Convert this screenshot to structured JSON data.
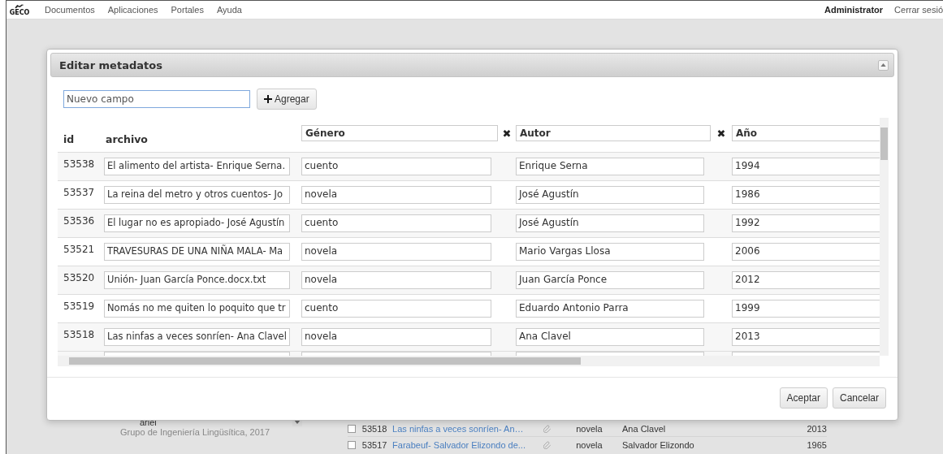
{
  "navbar": {
    "logo_text": "GECO",
    "menu": [
      "Documentos",
      "Aplicaciones",
      "Portales",
      "Ayuda"
    ],
    "user": "Administrator",
    "logout": "Cerrar sesió"
  },
  "background": {
    "user_select": "ariel",
    "footer": "Grupo de Ingeniería Lingüsítica, 2017",
    "rows": [
      {
        "checked": false,
        "id": "53518",
        "archivo": "Las ninfas a veces sonríen- An…",
        "genero": "novela",
        "autor": "Ana Clavel",
        "anio": "2013"
      },
      {
        "checked": false,
        "id": "53517",
        "archivo": "Farabeuf- Salvador Elizondo de...",
        "genero": "novela",
        "autor": "Salvador Elizondo",
        "anio": "1965"
      }
    ]
  },
  "dialog": {
    "title": "Editar metadatos",
    "new_field": {
      "placeholder": "Nuevo campo"
    },
    "add_button": "Agregar",
    "id_header": "id",
    "file_header": "archivo",
    "columns": [
      {
        "name": "Género",
        "remove": "✖"
      },
      {
        "name": "Autor",
        "remove": "✖"
      },
      {
        "name": "Año"
      }
    ],
    "rows": [
      {
        "id": "53538",
        "archivo": "El alimento del artista- Enrique Serna.",
        "values": [
          "cuento",
          "Enrique Serna",
          "1994"
        ]
      },
      {
        "id": "53537",
        "archivo": "La reina del metro y otros cuentos- Jo",
        "values": [
          "novela",
          "José Agustín",
          "1986"
        ]
      },
      {
        "id": "53536",
        "archivo": "El lugar no es apropiado- José Agustín",
        "values": [
          "cuento",
          "José Agustín",
          "1992"
        ]
      },
      {
        "id": "53521",
        "archivo": "TRAVESURAS DE UNA NIÑA MALA- Ma",
        "values": [
          "novela",
          "Mario Vargas Llosa",
          "2006"
        ]
      },
      {
        "id": "53520",
        "archivo": "Unión- Juan García Ponce.docx.txt",
        "values": [
          "novela",
          "Juan García Ponce",
          "2012"
        ]
      },
      {
        "id": "53519",
        "archivo": "Nomás no me quiten lo poquito que tr",
        "values": [
          "cuento",
          "Eduardo Antonio Parra",
          "1999"
        ]
      },
      {
        "id": "53518",
        "archivo": "Las ninfas a veces sonríen- Ana Clavel",
        "values": [
          "novela",
          "Ana Clavel",
          "2013"
        ]
      }
    ],
    "buttons": [
      "Aceptar",
      "Cancelar"
    ]
  }
}
